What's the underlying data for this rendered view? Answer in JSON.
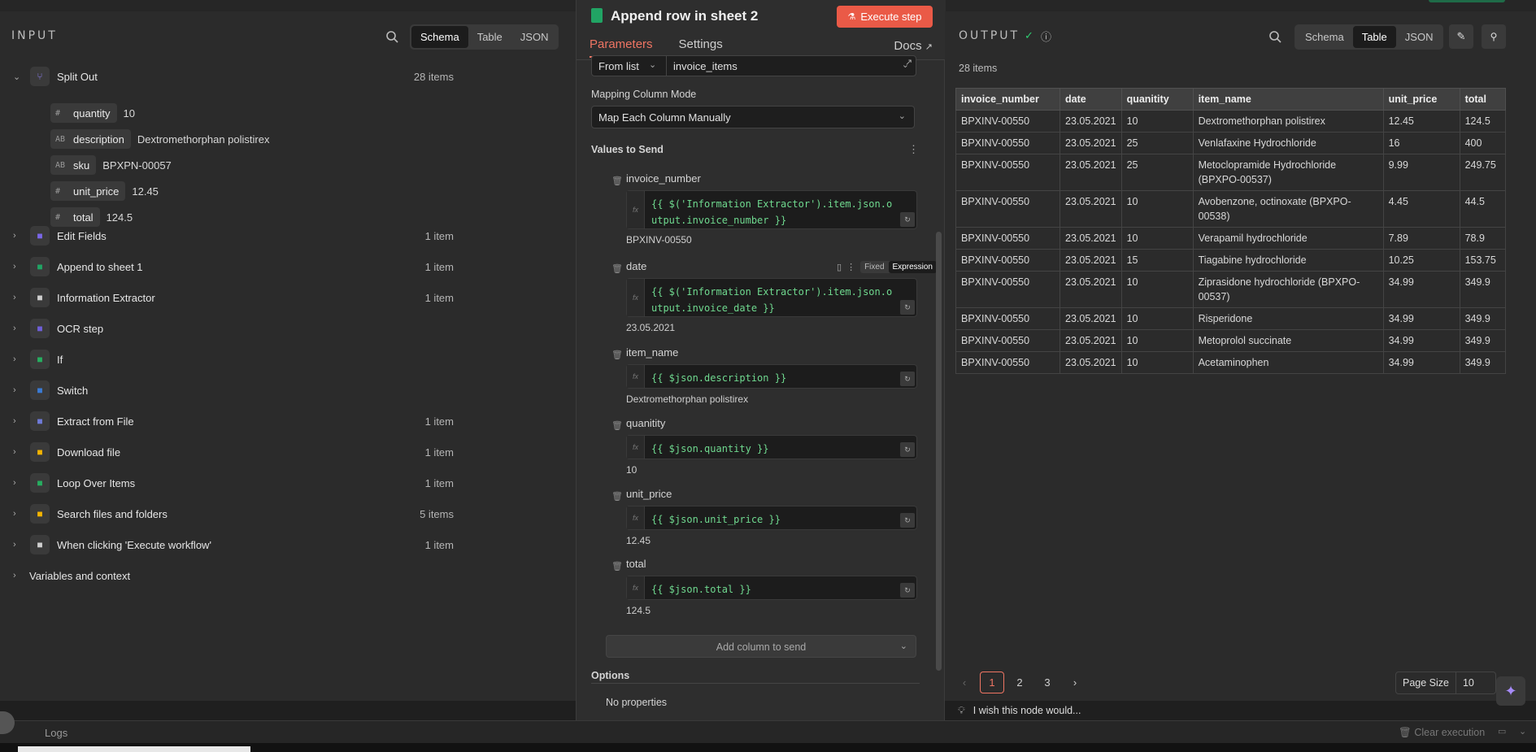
{
  "input": {
    "title": "INPUT",
    "views": [
      "Schema",
      "Table",
      "JSON"
    ],
    "active_view": "Schema",
    "root": {
      "label": "Split Out",
      "count": "28 items"
    },
    "fields": [
      {
        "type": "#",
        "key": "quantity",
        "value": "10"
      },
      {
        "type": "AB",
        "key": "description",
        "value": "Dextromethorphan polistirex"
      },
      {
        "type": "AB",
        "key": "sku",
        "value": "BPXPN-00057"
      },
      {
        "type": "#",
        "key": "unit_price",
        "value": "12.45"
      },
      {
        "type": "#",
        "key": "total",
        "value": "124.5"
      }
    ],
    "nodes": [
      {
        "label": "Edit Fields",
        "count": "1 item",
        "icon_color": "#7a67e8"
      },
      {
        "label": "Append to sheet 1",
        "count": "1 item",
        "icon_color": "#21a464"
      },
      {
        "label": "Information Extractor",
        "count": "1 item",
        "icon_color": "#cfcfcf"
      },
      {
        "label": "OCR step",
        "count": "",
        "icon_color": "#6f5fd8"
      },
      {
        "label": "If",
        "count": "",
        "icon_color": "#27ae60"
      },
      {
        "label": "Switch",
        "count": "",
        "icon_color": "#3a7bd5"
      },
      {
        "label": "Extract from File",
        "count": "1 item",
        "icon_color": "#6f7bd8"
      },
      {
        "label": "Download file",
        "count": "1 item",
        "icon_color": "#f4b400"
      },
      {
        "label": "Loop Over Items",
        "count": "1 item",
        "icon_color": "#27ae60"
      },
      {
        "label": "Search files and folders",
        "count": "5 items",
        "icon_color": "#f4b400"
      },
      {
        "label": "When clicking 'Execute workflow'",
        "count": "1 item",
        "icon_color": "#cfcfcf"
      }
    ],
    "variables": "Variables and context"
  },
  "node_panel": {
    "title": "Append row in sheet 2",
    "execute_label": "Execute step",
    "tabs": [
      "Parameters",
      "Settings"
    ],
    "docs_label": "Docs",
    "sheet_mode": "From list",
    "sheet_value": "invoice_items",
    "mapping_label": "Mapping Column Mode",
    "mapping_value": "Map Each Column Manually",
    "values_label": "Values to Send",
    "fixed_label": "Fixed",
    "expression_label": "Expression",
    "columns": [
      {
        "name": "invoice_number",
        "expr": "{{ $('Information Extractor').item.json.output.invoice_number }}",
        "result": "BPXINV-00550"
      },
      {
        "name": "date",
        "expr": "{{ $('Information Extractor').item.json.output.invoice_date }}",
        "result": "23.05.2021"
      },
      {
        "name": "item_name",
        "expr": "{{ $json.description }}",
        "result": "Dextromethorphan polistirex"
      },
      {
        "name": "quanitity",
        "expr": "{{ $json.quantity }}",
        "result": "10"
      },
      {
        "name": "unit_price",
        "expr": "{{ $json.unit_price }}",
        "result": "12.45"
      },
      {
        "name": "total",
        "expr": "{{ $json.total }}",
        "result": "124.5"
      }
    ],
    "add_column_label": "Add column to send",
    "options_label": "Options",
    "no_properties": "No properties",
    "wish_text": "I wish this node would..."
  },
  "output": {
    "title": "OUTPUT",
    "views": [
      "Schema",
      "Table",
      "JSON"
    ],
    "active_view": "Table",
    "count": "28 items",
    "columns": [
      "invoice_number",
      "date",
      "quanitity",
      "item_name",
      "unit_price",
      "total"
    ],
    "rows": [
      [
        "BPXINV-00550",
        "23.05.2021",
        "10",
        "Dextromethorphan polistirex",
        "12.45",
        "124.5"
      ],
      [
        "BPXINV-00550",
        "23.05.2021",
        "25",
        "Venlafaxine Hydrochloride",
        "16",
        "400"
      ],
      [
        "BPXINV-00550",
        "23.05.2021",
        "25",
        "Metoclopramide Hydrochloride (BPXPO-00537)",
        "9.99",
        "249.75"
      ],
      [
        "BPXINV-00550",
        "23.05.2021",
        "10",
        "Avobenzone, octinoxate (BPXPO-00538)",
        "4.45",
        "44.5"
      ],
      [
        "BPXINV-00550",
        "23.05.2021",
        "10",
        "Verapamil hydrochloride",
        "7.89",
        "78.9"
      ],
      [
        "BPXINV-00550",
        "23.05.2021",
        "15",
        "Tiagabine hydrochloride",
        "10.25",
        "153.75"
      ],
      [
        "BPXINV-00550",
        "23.05.2021",
        "10",
        "Ziprasidone hydrochloride (BPXPO-00537)",
        "34.99",
        "349.9"
      ],
      [
        "BPXINV-00550",
        "23.05.2021",
        "10",
        "Risperidone",
        "34.99",
        "349.9"
      ],
      [
        "BPXINV-00550",
        "23.05.2021",
        "10",
        "Metoprolol succinate",
        "34.99",
        "349.9"
      ],
      [
        "BPXINV-00550",
        "23.05.2021",
        "10",
        "Acetaminophen",
        "34.99",
        "349.9"
      ]
    ],
    "pages": [
      "1",
      "2",
      "3"
    ],
    "page_size_label": "Page Size",
    "page_size": "10"
  },
  "footer": {
    "logs_label": "Logs",
    "clear_label": "Clear execution"
  },
  "colors": {
    "accent": "#ef7563",
    "execute": "#ea5a47",
    "code": "#6fd98f"
  }
}
